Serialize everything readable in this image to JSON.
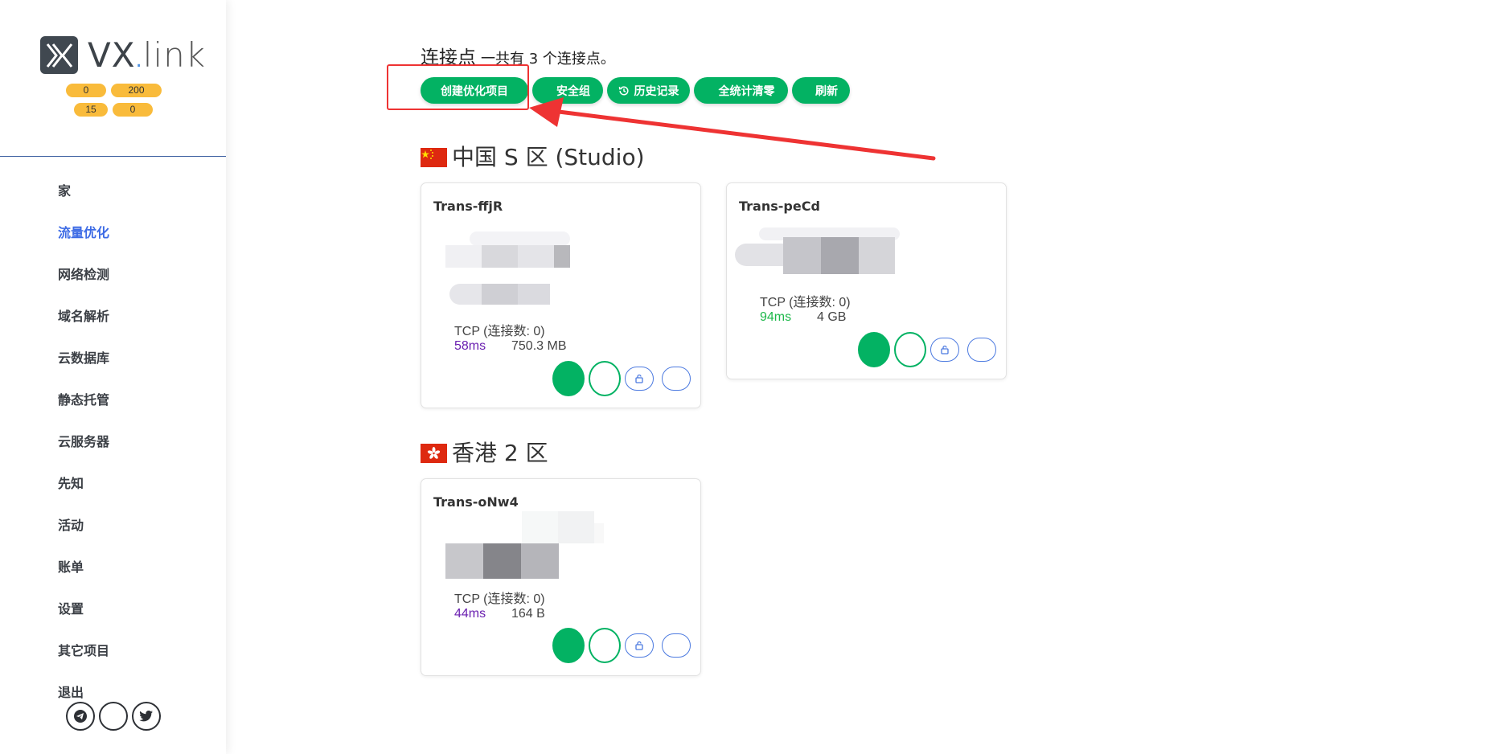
{
  "brand": {
    "name_main": "VX",
    "name_dot": ".",
    "name_tail": "link"
  },
  "stats": [
    "0",
    "200",
    "15",
    "0"
  ],
  "nav": [
    {
      "label": "家"
    },
    {
      "label": "流量优化",
      "active": true
    },
    {
      "label": "网络检测"
    },
    {
      "label": "域名解析"
    },
    {
      "label": "云数据库"
    },
    {
      "label": "静态托管"
    },
    {
      "label": "云服务器"
    },
    {
      "label": "先知"
    },
    {
      "label": "活动"
    },
    {
      "label": "账单"
    },
    {
      "label": "设置"
    },
    {
      "label": "其它项目"
    },
    {
      "label": "退出"
    }
  ],
  "social": [
    "telegram-icon",
    "blank-icon",
    "twitter-icon"
  ],
  "header": {
    "title": "连接点",
    "subtitle": "一共有 3 个连接点。"
  },
  "toolbar": [
    {
      "label": "创建优化项目",
      "icon": ""
    },
    {
      "label": "安全组",
      "icon": ""
    },
    {
      "label": "历史记录",
      "icon": "history-icon"
    },
    {
      "label": "全统计清零",
      "icon": ""
    },
    {
      "label": "刷新",
      "icon": ""
    }
  ],
  "regions": [
    {
      "name": "中国 S 区 (Studio)",
      "flag": "china-flag",
      "nodes": [
        {
          "name": "Trans-ffjR",
          "tcp": "TCP (连接数: 0)",
          "latency": "58ms",
          "latency_color": "#6a1fb0",
          "traffic": "750.3 MB"
        },
        {
          "name": "Trans-peCd",
          "tcp": "TCP (连接数: 0)",
          "latency": "94ms",
          "latency_color": "#1db84a",
          "traffic": "4 GB"
        }
      ]
    },
    {
      "name": "香港 2 区",
      "flag": "hong-kong-flag",
      "nodes": [
        {
          "name": "Trans-oNw4",
          "tcp": "TCP (连接数: 0)",
          "latency": "44ms",
          "latency_color": "#6a1fb0",
          "traffic": "164 B"
        }
      ]
    }
  ],
  "colors": {
    "primary_green": "#03b263",
    "accent_blue": "#3d6be5",
    "badge_yellow": "#f9bb3b",
    "annotation_red": "#ee3333"
  }
}
